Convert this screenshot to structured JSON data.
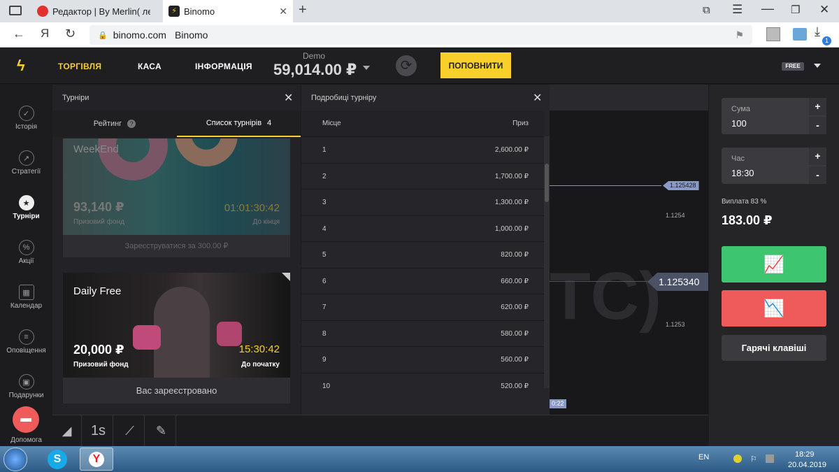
{
  "browser": {
    "tabs": [
      {
        "label": "Редактор | By Merlin( легкий"
      },
      {
        "label": "Binomo"
      }
    ],
    "url_host": "binomo.com",
    "url_title": "Binomo",
    "nav_letter": "Я",
    "download_badge": "1"
  },
  "header": {
    "nav": [
      "ТОРГІВЛЯ",
      "КАСА",
      "ІНФОРМАЦІЯ"
    ],
    "account_type": "Demo",
    "balance": "59,014.00 ₽",
    "deposit_label": "ПОПОВНИТИ",
    "badge": "FREE"
  },
  "sidebar": {
    "items": [
      {
        "label": "Історія"
      },
      {
        "label": "Стратегії"
      },
      {
        "label": "Турніри"
      },
      {
        "label": "Акції"
      },
      {
        "label": "Календар"
      },
      {
        "label": "Оповіщення"
      },
      {
        "label": "Подарунки"
      },
      {
        "label": "Допомога"
      }
    ]
  },
  "tournaments": {
    "title": "Турніри",
    "tabs": [
      {
        "label": "Рейтинг"
      },
      {
        "label": "Список турнірів",
        "count": "4"
      }
    ],
    "cards": [
      {
        "name": "WeekEnd",
        "prize": "93,140 ₽",
        "prize_label": "Призовий фонд",
        "timer": "01:01:30:42",
        "timer_label": "До кінця",
        "action": "Зареєструватися за 300.00 ₽"
      },
      {
        "name": "Daily Free",
        "prize": "20,000 ₽",
        "prize_label": "Призовий фонд",
        "timer": "15:30:42",
        "timer_label": "До початку",
        "action": "Вас зареєстровано"
      }
    ]
  },
  "details": {
    "title": "Подробиці турніру",
    "col_place": "Місце",
    "col_prize": "Приз",
    "rows": [
      {
        "place": "1",
        "prize": "2,600.00 ₽"
      },
      {
        "place": "2",
        "prize": "1,700.00 ₽"
      },
      {
        "place": "3",
        "prize": "1,300.00 ₽"
      },
      {
        "place": "4",
        "prize": "1,000.00 ₽"
      },
      {
        "place": "5",
        "prize": "820.00 ₽"
      },
      {
        "place": "6",
        "prize": "660.00 ₽"
      },
      {
        "place": "7",
        "prize": "620.00 ₽"
      },
      {
        "place": "8",
        "prize": "580.00 ₽"
      },
      {
        "place": "9",
        "prize": "560.00 ₽"
      },
      {
        "place": "10",
        "prize": "520.00 ₽"
      }
    ]
  },
  "chart": {
    "tag_small": "1.125428",
    "grid_top": "1.1254",
    "price": "1.125340",
    "grid_bottom": "1.1253",
    "bg_text": "TC)",
    "time_tag": "0:22"
  },
  "trade": {
    "amount_label": "Сума",
    "amount": "100",
    "time_label": "Час",
    "time": "18:30",
    "payout_label": "Виплата 83 %",
    "payout": "183.00 ₽",
    "hotkeys": "Гарячі клавіші",
    "up_color": "#3dc66f",
    "down_color": "#ef5b5b"
  },
  "toolbar": {
    "timeframe": "1s"
  },
  "taskbar": {
    "lang": "EN",
    "time": "18:29",
    "date": "20.04.2019"
  }
}
